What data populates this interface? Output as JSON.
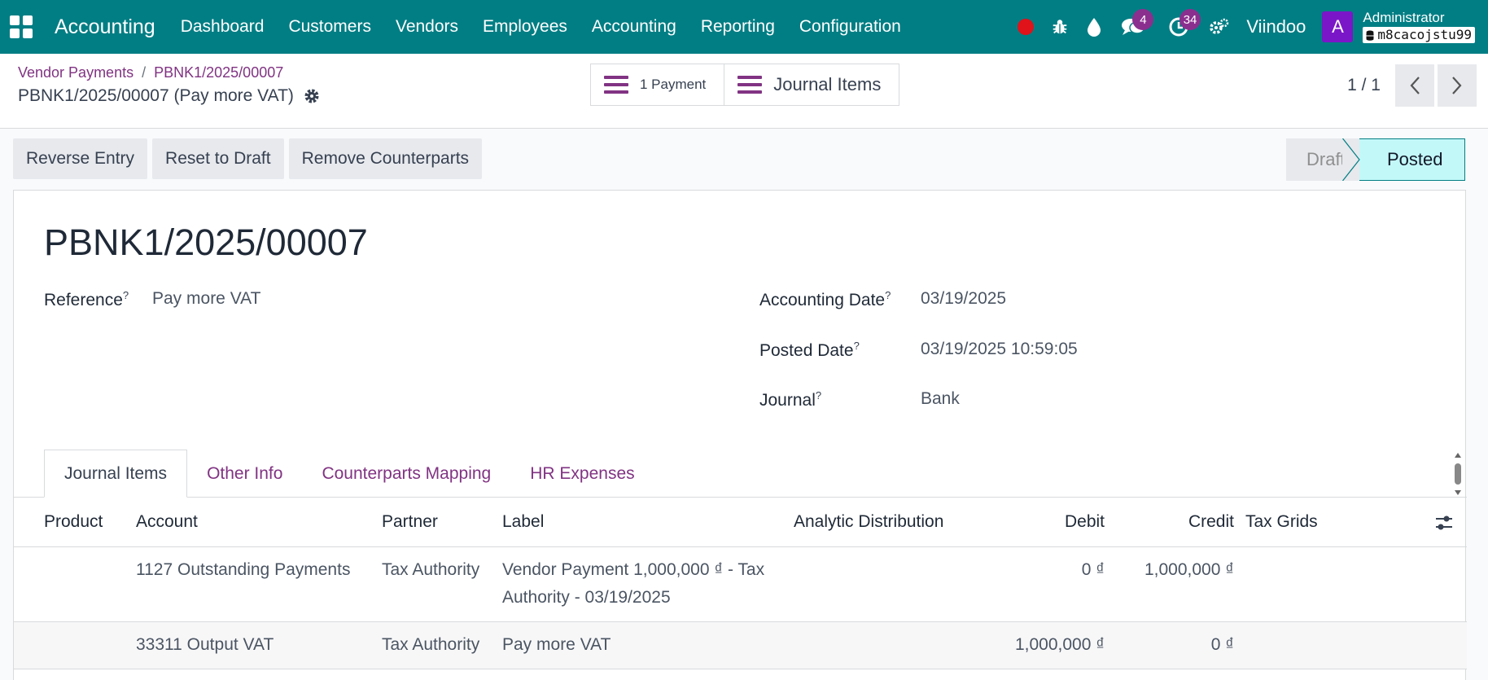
{
  "navbar": {
    "app_title": "Accounting",
    "menu": [
      "Dashboard",
      "Customers",
      "Vendors",
      "Employees",
      "Accounting",
      "Reporting",
      "Configuration"
    ],
    "messages_count": "4",
    "activities_count": "34",
    "company": "Viindoo",
    "avatar_letter": "A",
    "user_name": "Administrator",
    "database": "m8cacojstu99",
    "accent_color": "#017e84"
  },
  "breadcrumb": {
    "parent": "Vendor Payments",
    "current": "PBNK1/2025/00007"
  },
  "record_title": "PBNK1/2025/00007 (Pay more VAT)",
  "smart_buttons": {
    "payment": "1 Payment",
    "journal_items": "Journal Items"
  },
  "pager": {
    "value": "1 / 1"
  },
  "actions": {
    "reverse_entry": "Reverse Entry",
    "reset_to_draft": "Reset to Draft",
    "remove_counterparts": "Remove Counterparts"
  },
  "status": {
    "draft": "Draft",
    "posted": "Posted",
    "current": "Posted"
  },
  "sheet": {
    "move_name": "PBNK1/2025/00007",
    "reference_label": "Reference",
    "reference_value": "Pay more VAT",
    "accounting_date_label": "Accounting Date",
    "accounting_date_value": "03/19/2025",
    "posted_date_label": "Posted Date",
    "posted_date_value": "03/19/2025 10:59:05",
    "journal_label": "Journal",
    "journal_value": "Bank",
    "help_mark": "?"
  },
  "tabs": [
    "Journal Items",
    "Other Info",
    "Counterparts Mapping",
    "HR Expenses"
  ],
  "table": {
    "headers": {
      "product": "Product",
      "account": "Account",
      "partner": "Partner",
      "label": "Label",
      "analytic": "Analytic Distribution",
      "debit": "Debit",
      "credit": "Credit",
      "tax_grids": "Tax Grids"
    },
    "rows": [
      {
        "product": "",
        "account": "1127 Outstanding Payments",
        "partner": "Tax Authority",
        "label_line1": "Vendor Payment 1,000,000 ₫ - Tax",
        "label_line2": "Authority - 03/19/2025",
        "debit": "0 ₫",
        "credit": "1,000,000 ₫"
      },
      {
        "product": "",
        "account": "33311 Output VAT",
        "partner": "Tax Authority",
        "label_line1": "Pay more VAT",
        "debit": "1,000,000 ₫",
        "credit": "0 ₫"
      }
    ]
  }
}
